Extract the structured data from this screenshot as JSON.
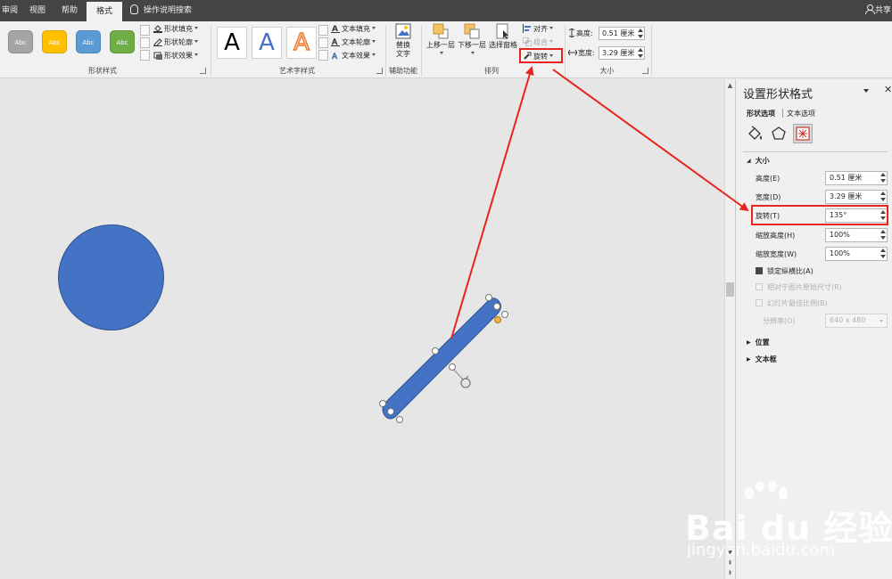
{
  "tabs": [
    {
      "label": "审阅",
      "active": false
    },
    {
      "label": "视图",
      "active": false
    },
    {
      "label": "帮助",
      "active": false
    },
    {
      "label": "格式",
      "active": true
    }
  ],
  "tell_me": "操作说明搜索",
  "share": "共享",
  "ribbon": {
    "shape_styles": {
      "label": "形状样式",
      "swatches": [
        {
          "text": "Abc",
          "color": "#a5a5a5"
        },
        {
          "text": "Abc",
          "color": "#ffc000"
        },
        {
          "text": "Abc",
          "color": "#5b9bd5"
        },
        {
          "text": "Abc",
          "color": "#70ad47"
        }
      ],
      "fill": "形状填充",
      "outline": "形状轮廓",
      "effects": "形状效果"
    },
    "wordart": {
      "label": "艺术字样式",
      "samples": [
        "A",
        "A",
        "A"
      ],
      "text_fill": "文本填充",
      "text_outline": "文本轮廓",
      "text_effects": "文本效果"
    },
    "accessibility": {
      "label": "辅助功能",
      "alt_text_line1": "替换",
      "alt_text_line2": "文字"
    },
    "arrange": {
      "label": "排列",
      "bring_forward": "上移一层",
      "send_backward": "下移一层",
      "selection_pane": "选择窗格",
      "align": "对齐",
      "group": "组合",
      "rotate": "旋转"
    },
    "size": {
      "label": "大小",
      "height_label": "高度:",
      "height_value": "0.51 厘米",
      "width_label": "宽度:",
      "width_value": "3.29 厘米"
    }
  },
  "canvas": {
    "circle_color": "#4472c4",
    "bar_color": "#4472c4",
    "bar_rotation_deg": 135
  },
  "pane": {
    "title": "设置形状格式",
    "tab_shape": "形状选项",
    "tab_text": "文本选项",
    "section_size": "大小",
    "height_label": "高度(E)",
    "height_value": "0.51 厘米",
    "width_label": "宽度(D)",
    "width_value": "3.29 厘米",
    "rotation_label": "旋转(T)",
    "rotation_value": "135°",
    "scale_height_label": "缩放高度(H)",
    "scale_height_value": "100%",
    "scale_width_label": "缩放宽度(W)",
    "scale_width_value": "100%",
    "lock_aspect": "锁定纵横比(A)",
    "relative_original": "相对于图片原始尺寸(R)",
    "best_scale": "幻灯片最佳比例(B)",
    "resolution_label": "分辨率(O)",
    "resolution_value": "640 x 480",
    "section_position": "位置",
    "section_textbox": "文本框"
  },
  "watermark": {
    "brand": "Bai du 经验",
    "url": "jingyan.baidu.com"
  },
  "colors": {
    "highlight_red": "#e8241f",
    "accent_blue": "#4472c4"
  }
}
